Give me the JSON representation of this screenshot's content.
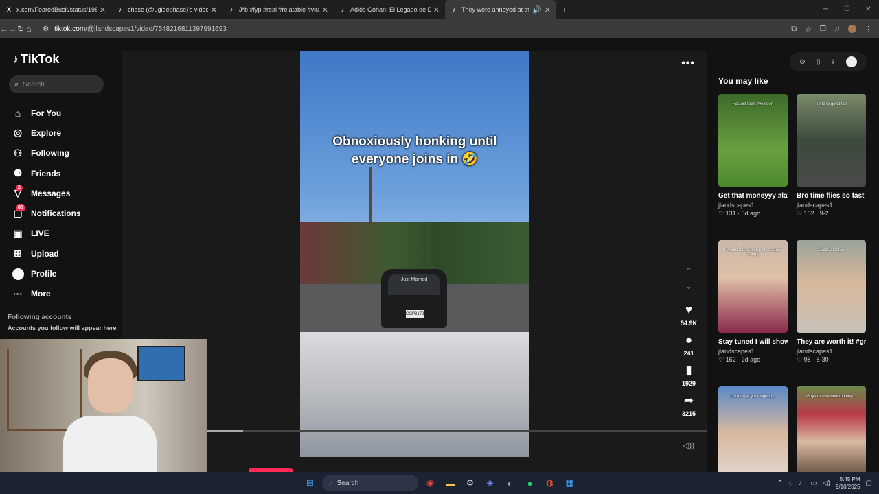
{
  "browser": {
    "tabs": [
      {
        "title": "x.com/FearedBuck/status/19656",
        "icon": "x-logo"
      },
      {
        "title": "chase (@ugleephase)'s video o",
        "icon": "tiktok-logo"
      },
      {
        "title": "J*b #fyp #real #relatable #viral",
        "icon": "tiktok-logo"
      },
      {
        "title": "Adiós Gohan: El Legado de Dra",
        "icon": "tiktok-logo"
      },
      {
        "title": "They were annoyed at the e",
        "icon": "tiktok-logo",
        "active": true
      }
    ],
    "url_host": "tiktok.com",
    "url_path": "/@jlandscapes1/video/7548216811397991693"
  },
  "sidebar": {
    "logo": "TikTok",
    "search_placeholder": "Search",
    "items": [
      {
        "label": "For You",
        "icon": "home-icon"
      },
      {
        "label": "Explore",
        "icon": "compass-icon"
      },
      {
        "label": "Following",
        "icon": "following-icon"
      },
      {
        "label": "Friends",
        "icon": "friends-icon"
      },
      {
        "label": "Messages",
        "icon": "messages-icon",
        "badge": "2"
      },
      {
        "label": "Notifications",
        "icon": "bell-icon",
        "badge": "88"
      },
      {
        "label": "LIVE",
        "icon": "live-icon"
      },
      {
        "label": "Upload",
        "icon": "upload-icon"
      },
      {
        "label": "Profile",
        "icon": "profile-icon"
      },
      {
        "label": "More",
        "icon": "more-icon"
      }
    ],
    "following_heading": "Following accounts",
    "following_sub": "Accounts you follow will appear here"
  },
  "video": {
    "caption_line1": "Obnoxiously honking until",
    "caption_line2": "everyone joins in 🤣",
    "car_window_text": "Just Married",
    "plate": "CGP3172"
  },
  "actions": {
    "likes": "54.9K",
    "comments": "241",
    "saves": "1929",
    "shares": "3215"
  },
  "recommendations": {
    "heading": "You may like",
    "cards": [
      {
        "title": "Get that moneyyy #lawncare #grasst...",
        "user": "jlandscapes1",
        "likes": "131",
        "age": "5d ago",
        "overlay": "Fastest lawn I've seen"
      },
      {
        "title": "Bro time flies so fast #fyp #lawncare...",
        "user": "jlandscapes1",
        "likes": "102",
        "age": "9-2",
        "overlay": "Time to go to fall"
      },
      {
        "title": "Stay tuned I will show the other spo...",
        "user": "jlandscapes1",
        "likes": "162",
        "age": "2d ago",
        "overlay": "I would rather be up at stranger things"
      },
      {
        "title": "They are worth it! #grasstok #lawnca...",
        "user": "jlandscapes1",
        "likes": "98",
        "age": "8-30",
        "overlay": "Oakley metas"
      },
      {
        "title": "",
        "user": "",
        "likes": "",
        "age": "",
        "overlay": "Looking at your signup..."
      },
      {
        "title": "",
        "user": "",
        "likes": "",
        "age": "",
        "overlay": "Guys tell me how to keep..."
      }
    ]
  },
  "taskbar": {
    "search_label": "Search",
    "time": "5:45 PM",
    "date": "9/10/2025"
  },
  "colors": {
    "accent": "#fe2c55",
    "page_bg": "#121212"
  }
}
